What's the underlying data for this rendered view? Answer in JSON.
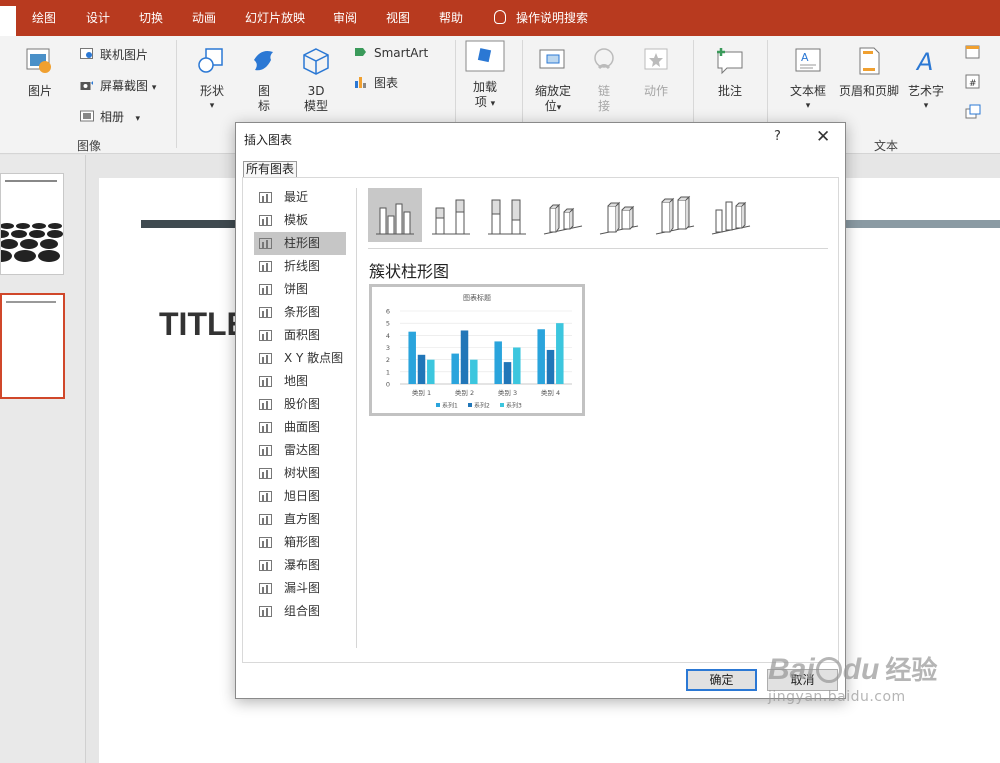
{
  "tabs": [
    {
      "label": "绘图"
    },
    {
      "label": "设计"
    },
    {
      "label": "切换"
    },
    {
      "label": "动画"
    },
    {
      "label": "幻灯片放映"
    },
    {
      "label": "审阅"
    },
    {
      "label": "视图"
    },
    {
      "label": "帮助"
    }
  ],
  "tell_me": "操作说明搜索",
  "ribbon": {
    "images": {
      "picture": "图片",
      "online_picture": "联机图片",
      "screenshot": "屏幕截图",
      "album": "相册",
      "group": "图像"
    },
    "illustrations": {
      "shapes": "形状",
      "icons_1": "图",
      "icons_2": "标",
      "models_1": "3D",
      "models_2": "模型",
      "smartart": "SmartArt",
      "chart": "图表"
    },
    "addins": {
      "label_1": "加载",
      "label_2": "项"
    },
    "links": {
      "zoom_1": "缩放定",
      "zoom_2": "位",
      "link_1": "链",
      "link_2": "接",
      "action": "动作"
    },
    "comments": {
      "comment": "批注"
    },
    "text": {
      "textbox": "文本框",
      "header_footer": "页眉和页脚",
      "wordart": "艺术字",
      "group": "文本"
    }
  },
  "slide": {
    "title": "TITLE"
  },
  "dialog": {
    "title": "插入图表",
    "help": "?",
    "close": "✕",
    "tab": "所有图表",
    "categories": [
      {
        "label": "最近",
        "icon": "recent-icon"
      },
      {
        "label": "模板",
        "icon": "template-folder-icon"
      },
      {
        "label": "柱形图",
        "icon": "column-chart-icon"
      },
      {
        "label": "折线图",
        "icon": "line-chart-icon"
      },
      {
        "label": "饼图",
        "icon": "pie-chart-icon"
      },
      {
        "label": "条形图",
        "icon": "bar-chart-icon"
      },
      {
        "label": "面积图",
        "icon": "area-chart-icon"
      },
      {
        "label": "X Y 散点图",
        "icon": "scatter-chart-icon"
      },
      {
        "label": "地图",
        "icon": "map-chart-icon"
      },
      {
        "label": "股价图",
        "icon": "stock-chart-icon"
      },
      {
        "label": "曲面图",
        "icon": "surface-chart-icon"
      },
      {
        "label": "雷达图",
        "icon": "radar-chart-icon"
      },
      {
        "label": "树状图",
        "icon": "treemap-chart-icon"
      },
      {
        "label": "旭日图",
        "icon": "sunburst-chart-icon"
      },
      {
        "label": "直方图",
        "icon": "histogram-chart-icon"
      },
      {
        "label": "箱形图",
        "icon": "boxwhisker-chart-icon"
      },
      {
        "label": "瀑布图",
        "icon": "waterfall-chart-icon"
      },
      {
        "label": "漏斗图",
        "icon": "funnel-chart-icon"
      },
      {
        "label": "组合图",
        "icon": "combo-chart-icon"
      }
    ],
    "selected_category": 2,
    "subtype_name": "簇状柱形图",
    "ok": "确定",
    "cancel": "取消"
  },
  "colors": {
    "accent": "#b83a1f",
    "series1": "#2aa4dc",
    "series2": "#2176b8",
    "series3": "#3cc6de"
  },
  "chart_data": {
    "type": "bar",
    "title": "图表标题",
    "categories": [
      "类别 1",
      "类别 2",
      "类别 3",
      "类别 4"
    ],
    "series": [
      {
        "name": "系列1",
        "values": [
          4.3,
          2.5,
          3.5,
          4.5
        ]
      },
      {
        "name": "系列2",
        "values": [
          2.4,
          4.4,
          1.8,
          2.8
        ]
      },
      {
        "name": "系列3",
        "values": [
          2,
          2,
          3,
          5
        ]
      }
    ],
    "ylim": [
      0,
      6
    ],
    "yticks": [
      "0",
      "1",
      "2",
      "3",
      "4",
      "5",
      "6"
    ],
    "grid": true,
    "legend": "bottom"
  },
  "watermark": {
    "brand": "Bai",
    "brand2": "du",
    "jingyan": "经验",
    "url": "jingyan.baidu.com"
  }
}
